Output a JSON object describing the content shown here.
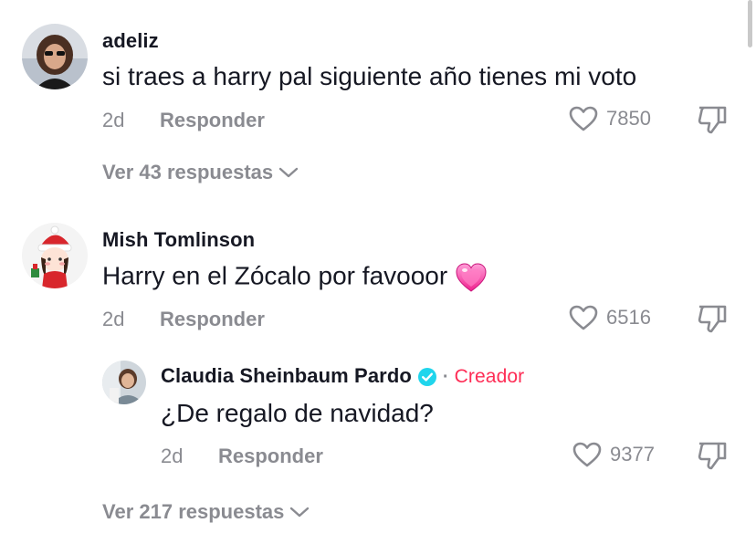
{
  "comments": [
    {
      "username": "adeliz",
      "text": "si traes a harry pal siguiente año tienes mi voto",
      "time": "2d",
      "reply_label": "Responder",
      "likes": "7850",
      "view_replies": "Ver 43 respuestas"
    },
    {
      "username": "Mish Tomlinson",
      "text": "Harry en el Zócalo por favooor",
      "emoji": "sparkling-heart",
      "time": "2d",
      "reply_label": "Responder",
      "likes": "6516",
      "reply": {
        "username": "Claudia Sheinbaum Pardo",
        "verified": true,
        "separator": "·",
        "badge": "Creador",
        "text": "¿De regalo de navidad?",
        "time": "2d",
        "reply_label": "Responder",
        "likes": "9377"
      },
      "view_replies": "Ver 217 respuestas"
    }
  ],
  "colors": {
    "text": "#161823",
    "secondary": "#8a8b91",
    "creator_badge": "#fe2c55",
    "verified": "#20d5ec"
  },
  "icons": [
    "heart-outline-icon",
    "thumbs-down-icon",
    "chevron-down-icon",
    "verified-badge-icon",
    "sparkling-heart-emoji"
  ]
}
